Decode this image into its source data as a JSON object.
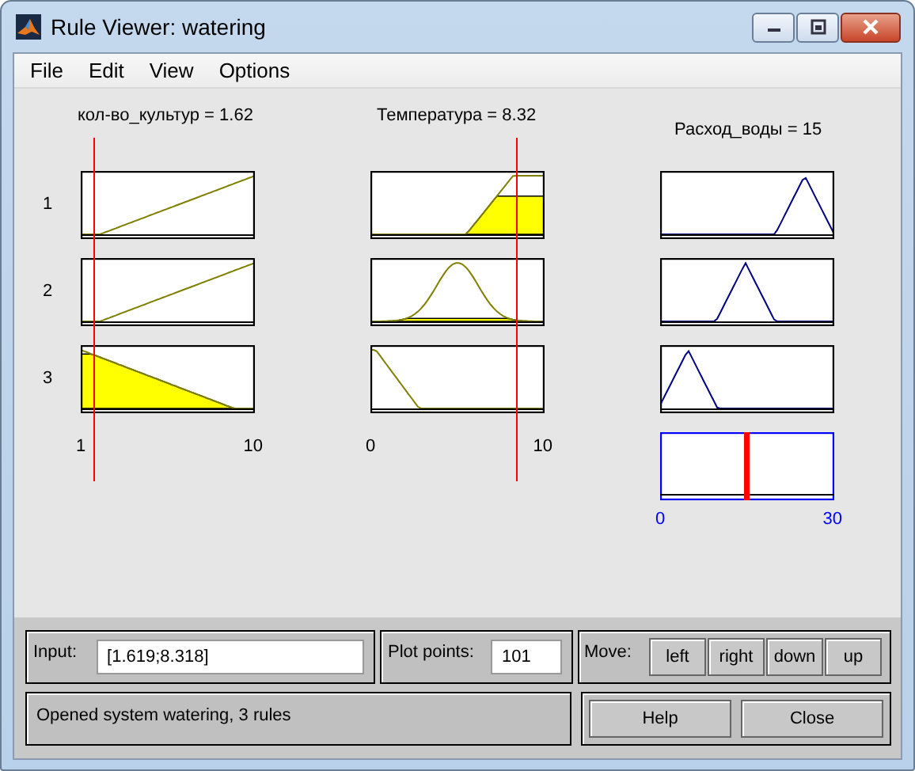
{
  "window": {
    "title": "Rule Viewer: watering"
  },
  "menu": [
    "File",
    "Edit",
    "View",
    "Options"
  ],
  "inputs": [
    {
      "header": "кол-во_культур = 1.62",
      "axis_min": "1",
      "axis_max": "10"
    },
    {
      "header": "Температура = 8.32",
      "axis_min": "0",
      "axis_max": "10"
    }
  ],
  "output": {
    "header": "Расход_воды = 15",
    "axis_min": "0",
    "axis_max": "30"
  },
  "rules": [
    "1",
    "2",
    "3"
  ],
  "input_field": {
    "label": "Input:",
    "value": "[1.619;8.318]"
  },
  "plot_points": {
    "label": "Plot points:",
    "value": "101"
  },
  "move": {
    "label": "Move:",
    "buttons": [
      "left",
      "right",
      "down",
      "up"
    ]
  },
  "status": "Opened system watering, 3 rules",
  "buttons": [
    "Help",
    "Close"
  ]
}
